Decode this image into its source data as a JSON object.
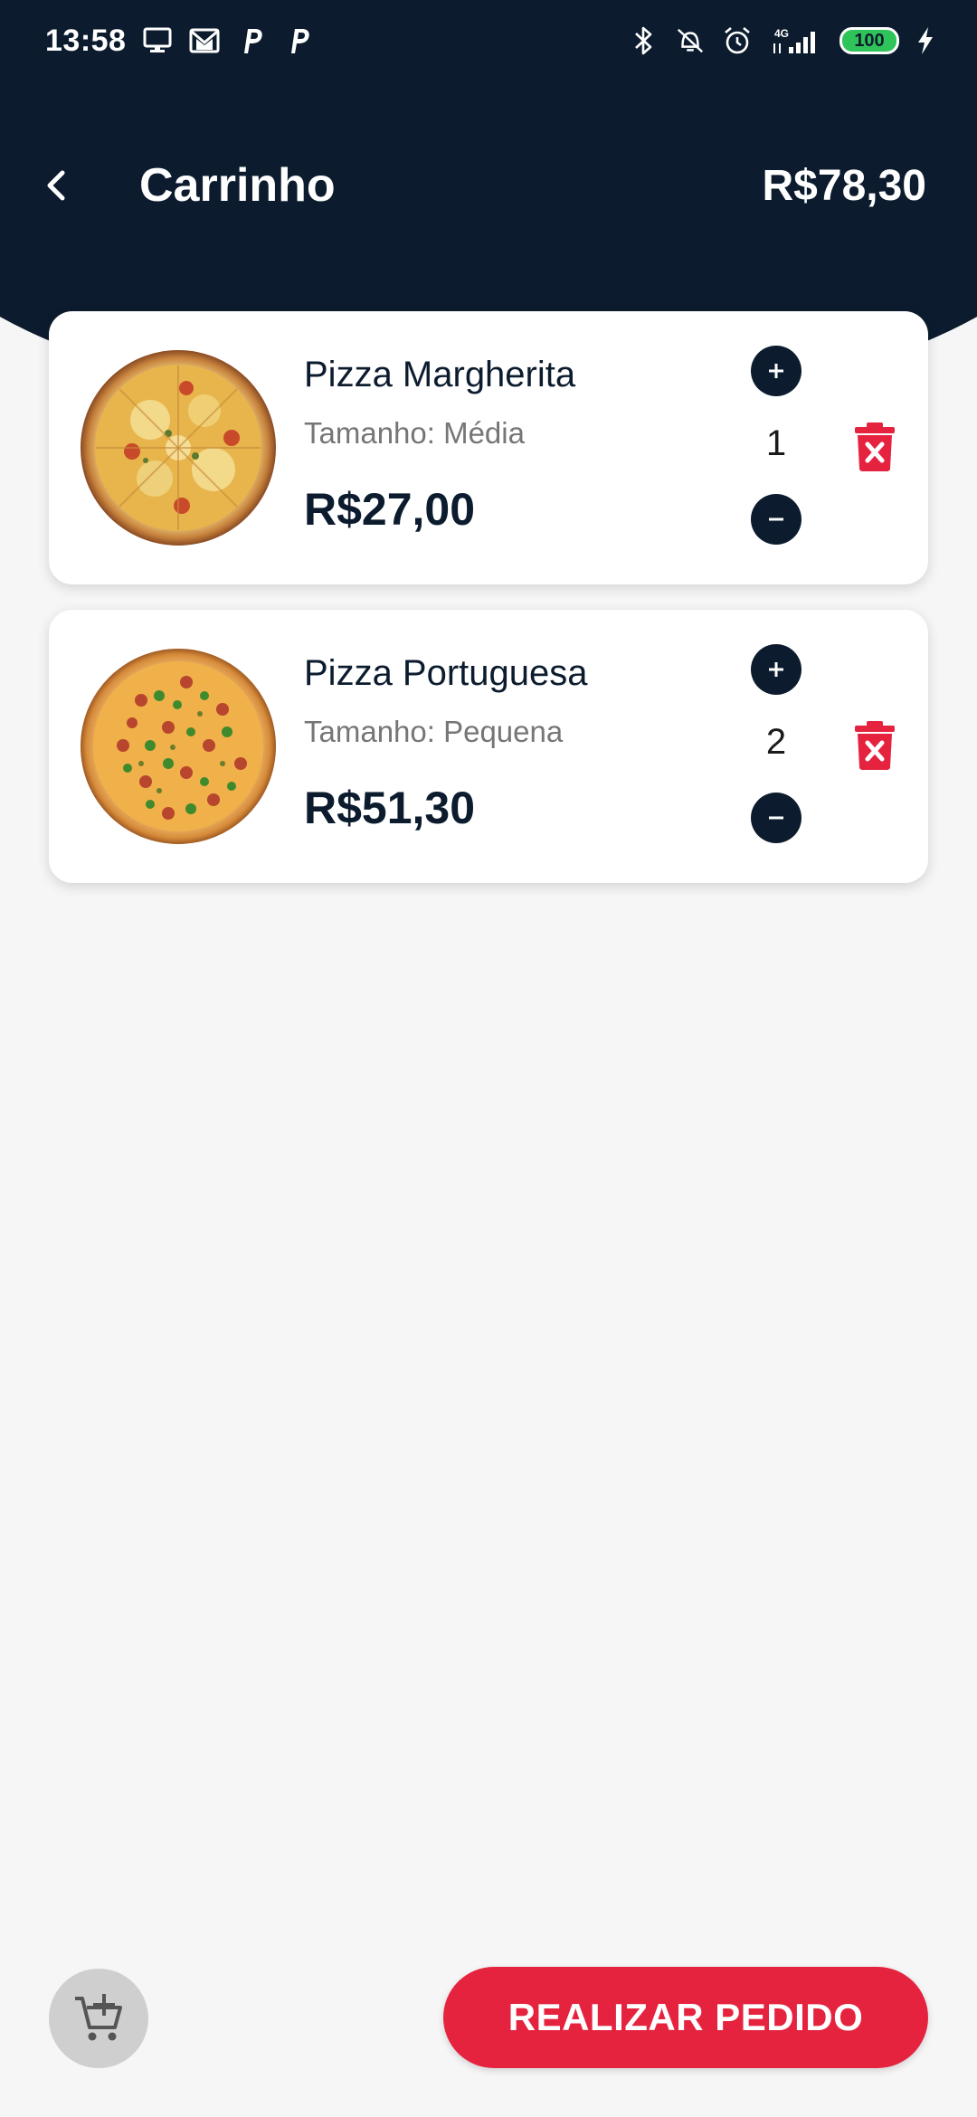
{
  "status_bar": {
    "time": "13:58",
    "battery": "100",
    "left_icons": [
      "monitor-icon",
      "gmail-icon",
      "p-icon",
      "p-icon"
    ],
    "right_icons": [
      "bluetooth-icon",
      "vibrate-off-icon",
      "alarm-icon",
      "signal-4g-icon",
      "battery-icon",
      "charging-icon"
    ]
  },
  "header": {
    "title": "Carrinho",
    "total": "R$78,30"
  },
  "cart": {
    "items": [
      {
        "name": "Pizza Margherita",
        "size": "Tamanho: Média",
        "price": "R$27,00",
        "quantity": "1",
        "image": "pizza-margherita-image"
      },
      {
        "name": "Pizza Portuguesa",
        "size": "Tamanho: Pequena",
        "price": "R$51,30",
        "quantity": "2",
        "image": "pizza-portuguesa-image"
      }
    ]
  },
  "footer": {
    "order_button": "REALIZAR PEDIDO",
    "add_cart_icon": "add-to-cart-icon"
  },
  "colors": {
    "header_bg": "#0c1c2e",
    "accent": "#e5233f",
    "page_bg": "#f6f6f6",
    "card_bg": "#ffffff"
  }
}
